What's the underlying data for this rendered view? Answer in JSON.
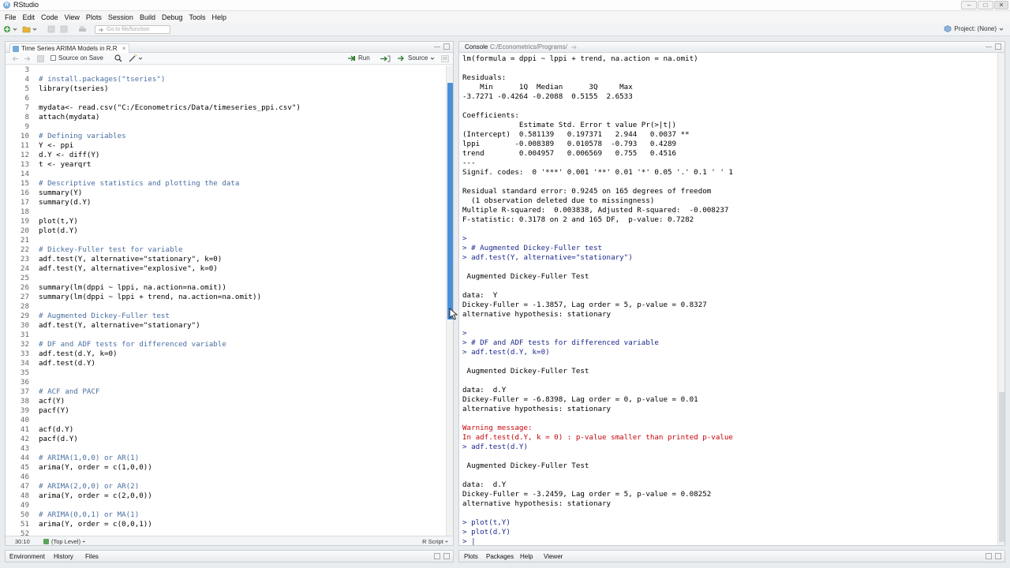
{
  "window": {
    "title": "RStudio",
    "logo": "R",
    "minimize": "–",
    "maximize": "□",
    "close": "✕"
  },
  "menu": [
    "File",
    "Edit",
    "Code",
    "View",
    "Plots",
    "Session",
    "Build",
    "Debug",
    "Tools",
    "Help"
  ],
  "toolbar": {
    "goto_placeholder": "Go to file/function",
    "project_label": "Project: (None)"
  },
  "editor": {
    "tab_title": "Time Series ARIMA Models in R.R",
    "tab_close": "×",
    "source_on_save": "Source on Save",
    "run_label": "Run",
    "source_label": "Source",
    "lines": [
      {
        "n": "3",
        "t": "",
        "c": false
      },
      {
        "n": "4",
        "t": "# install.packages(\"tseries\")",
        "c": true
      },
      {
        "n": "5",
        "t": "library(tseries)",
        "c": false
      },
      {
        "n": "6",
        "t": "",
        "c": false
      },
      {
        "n": "7",
        "t": "mydata<- read.csv(\"C:/Econometrics/Data/timeseries_ppi.csv\")",
        "c": false
      },
      {
        "n": "8",
        "t": "attach(mydata)",
        "c": false
      },
      {
        "n": "9",
        "t": "",
        "c": false
      },
      {
        "n": "10",
        "t": "# Defining variables",
        "c": true
      },
      {
        "n": "11",
        "t": "Y <- ppi",
        "c": false
      },
      {
        "n": "12",
        "t": "d.Y <- diff(Y)",
        "c": false
      },
      {
        "n": "13",
        "t": "t <- yearqrt",
        "c": false
      },
      {
        "n": "14",
        "t": "",
        "c": false
      },
      {
        "n": "15",
        "t": "# Descriptive statistics and plotting the data",
        "c": true
      },
      {
        "n": "16",
        "t": "summary(Y)",
        "c": false
      },
      {
        "n": "17",
        "t": "summary(d.Y)",
        "c": false
      },
      {
        "n": "18",
        "t": "",
        "c": false
      },
      {
        "n": "19",
        "t": "plot(t,Y)",
        "c": false
      },
      {
        "n": "20",
        "t": "plot(d.Y)",
        "c": false
      },
      {
        "n": "21",
        "t": "",
        "c": false
      },
      {
        "n": "22",
        "t": "# Dickey-Fuller test for variable",
        "c": true
      },
      {
        "n": "23",
        "t": "adf.test(Y, alternative=\"stationary\", k=0)",
        "c": false
      },
      {
        "n": "24",
        "t": "adf.test(Y, alternative=\"explosive\", k=0)",
        "c": false
      },
      {
        "n": "25",
        "t": "",
        "c": false
      },
      {
        "n": "26",
        "t": "summary(lm(dppi ~ lppi, na.action=na.omit))",
        "c": false
      },
      {
        "n": "27",
        "t": "summary(lm(dppi ~ lppi + trend, na.action=na.omit))",
        "c": false
      },
      {
        "n": "28",
        "t": "",
        "c": false
      },
      {
        "n": "29",
        "t": "# Augmented Dickey-Fuller test",
        "c": true
      },
      {
        "n": "30",
        "t": "adf.test(Y, alternative=\"stationary\")",
        "c": false
      },
      {
        "n": "31",
        "t": "",
        "c": false
      },
      {
        "n": "32",
        "t": "# DF and ADF tests for differenced variable",
        "c": true
      },
      {
        "n": "33",
        "t": "adf.test(d.Y, k=0)",
        "c": false
      },
      {
        "n": "34",
        "t": "adf.test(d.Y)",
        "c": false
      },
      {
        "n": "35",
        "t": "",
        "c": false
      },
      {
        "n": "36",
        "t": "",
        "c": false
      },
      {
        "n": "37",
        "t": "# ACF and PACF",
        "c": true
      },
      {
        "n": "38",
        "t": "acf(Y)",
        "c": false
      },
      {
        "n": "39",
        "t": "pacf(Y)",
        "c": false
      },
      {
        "n": "40",
        "t": "",
        "c": false
      },
      {
        "n": "41",
        "t": "acf(d.Y)",
        "c": false
      },
      {
        "n": "42",
        "t": "pacf(d.Y)",
        "c": false
      },
      {
        "n": "43",
        "t": "",
        "c": false
      },
      {
        "n": "44",
        "t": "# ARIMA(1,0,0) or AR(1)",
        "c": true
      },
      {
        "n": "45",
        "t": "arima(Y, order = c(1,0,0))",
        "c": false
      },
      {
        "n": "46",
        "t": "",
        "c": false
      },
      {
        "n": "47",
        "t": "# ARIMA(2,0,0) or AR(2)",
        "c": true
      },
      {
        "n": "48",
        "t": "arima(Y, order = c(2,0,0))",
        "c": false
      },
      {
        "n": "49",
        "t": "",
        "c": false
      },
      {
        "n": "50",
        "t": "# ARIMA(0,0,1) or MA(1)",
        "c": true
      },
      {
        "n": "51",
        "t": "arima(Y, order = c(0,0,1))",
        "c": false
      },
      {
        "n": "52",
        "t": "",
        "c": false
      }
    ],
    "status_position": "30:10",
    "status_level": "(Top Level) ÷",
    "status_filetype": "R Script ÷"
  },
  "console": {
    "tab_label": "Console",
    "path": "C:/Econometrics/Programs/",
    "lines": [
      {
        "t": "lm(formula = dppi ~ lppi + trend, na.action = na.omit)",
        "k": "out"
      },
      {
        "t": "",
        "k": "out"
      },
      {
        "t": "Residuals:",
        "k": "out"
      },
      {
        "t": "    Min      1Q  Median      3Q     Max",
        "k": "out"
      },
      {
        "t": "-3.7271 -0.4264 -0.2088  0.5155  2.6533",
        "k": "out"
      },
      {
        "t": "",
        "k": "out"
      },
      {
        "t": "Coefficients:",
        "k": "out"
      },
      {
        "t": "             Estimate Std. Error t value Pr(>|t|)",
        "k": "out"
      },
      {
        "t": "(Intercept)  0.581139   0.197371   2.944   0.0037 **",
        "k": "out"
      },
      {
        "t": "lppi        -0.008389   0.010578  -0.793   0.4289",
        "k": "out"
      },
      {
        "t": "trend        0.004957   0.006569   0.755   0.4516",
        "k": "out"
      },
      {
        "t": "---",
        "k": "out"
      },
      {
        "t": "Signif. codes:  0 '***' 0.001 '**' 0.01 '*' 0.05 '.' 0.1 ' ' 1",
        "k": "out"
      },
      {
        "t": "",
        "k": "out"
      },
      {
        "t": "Residual standard error: 0.9245 on 165 degrees of freedom",
        "k": "out"
      },
      {
        "t": "  (1 observation deleted due to missingness)",
        "k": "out"
      },
      {
        "t": "Multiple R-squared:  0.003838, Adjusted R-squared:  -0.008237",
        "k": "out"
      },
      {
        "t": "F-statistic: 0.3178 on 2 and 165 DF,  p-value: 0.7282",
        "k": "out"
      },
      {
        "t": "",
        "k": "out"
      },
      {
        "t": ">",
        "k": "cmd"
      },
      {
        "t": "> # Augmented Dickey-Fuller test",
        "k": "cmd"
      },
      {
        "t": "> adf.test(Y, alternative=\"stationary\")",
        "k": "cmd"
      },
      {
        "t": "",
        "k": "out"
      },
      {
        "t": " Augmented Dickey-Fuller Test",
        "k": "out"
      },
      {
        "t": "",
        "k": "out"
      },
      {
        "t": "data:  Y",
        "k": "out"
      },
      {
        "t": "Dickey-Fuller = -1.3857, Lag order = 5, p-value = 0.8327",
        "k": "out"
      },
      {
        "t": "alternative hypothesis: stationary",
        "k": "out"
      },
      {
        "t": "",
        "k": "out"
      },
      {
        "t": ">",
        "k": "cmd"
      },
      {
        "t": "> # DF and ADF tests for differenced variable",
        "k": "cmd"
      },
      {
        "t": "> adf.test(d.Y, k=0)",
        "k": "cmd"
      },
      {
        "t": "",
        "k": "out"
      },
      {
        "t": " Augmented Dickey-Fuller Test",
        "k": "out"
      },
      {
        "t": "",
        "k": "out"
      },
      {
        "t": "data:  d.Y",
        "k": "out"
      },
      {
        "t": "Dickey-Fuller = -6.8398, Lag order = 0, p-value = 0.01",
        "k": "out"
      },
      {
        "t": "alternative hypothesis: stationary",
        "k": "out"
      },
      {
        "t": "",
        "k": "out"
      },
      {
        "t": "Warning message:",
        "k": "warn"
      },
      {
        "t": "In adf.test(d.Y, k = 0) : p-value smaller than printed p-value",
        "k": "warn"
      },
      {
        "t": "> adf.test(d.Y)",
        "k": "cmd"
      },
      {
        "t": "",
        "k": "out"
      },
      {
        "t": " Augmented Dickey-Fuller Test",
        "k": "out"
      },
      {
        "t": "",
        "k": "out"
      },
      {
        "t": "data:  d.Y",
        "k": "out"
      },
      {
        "t": "Dickey-Fuller = -3.2459, Lag order = 5, p-value = 0.08252",
        "k": "out"
      },
      {
        "t": "alternative hypothesis: stationary",
        "k": "out"
      },
      {
        "t": "",
        "k": "out"
      },
      {
        "t": "> plot(t,Y)",
        "k": "cmd"
      },
      {
        "t": "> plot(d.Y)",
        "k": "cmd"
      },
      {
        "t": "> |",
        "k": "cmd"
      }
    ]
  },
  "bottom_left_tabs": [
    "Environment",
    "History",
    "Files"
  ],
  "bottom_right_tabs": [
    "Plots",
    "Packages",
    "Help",
    "Viewer"
  ],
  "colors": {
    "accent": "#4a90d9",
    "comment": "#4a6fa3",
    "console_command": "#1c2a8c",
    "warning": "#c5060b"
  }
}
